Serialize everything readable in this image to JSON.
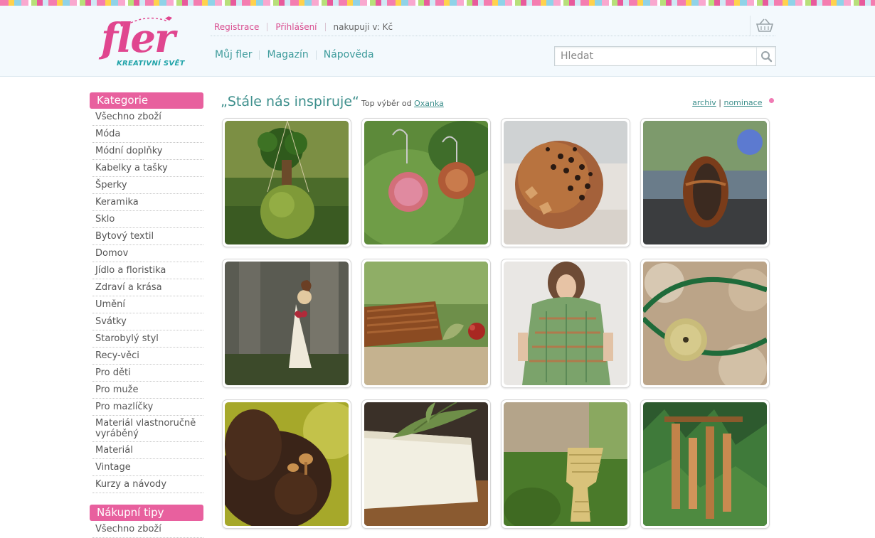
{
  "brand": {
    "logo_word": "fler",
    "logo_tagline": "KREATIVNÍ SVĚT"
  },
  "header": {
    "register": "Registrace",
    "login": "Přihlášení",
    "currency": "nakupuji v: Kč",
    "nav": [
      "Můj fler",
      "Magazín",
      "Nápověda"
    ],
    "search_placeholder": "Hledat"
  },
  "sidebar": {
    "categories_title": "Kategorie",
    "categories": [
      "Všechno zboží",
      "Móda",
      "Módní doplňky",
      "Kabelky a tašky",
      "Šperky",
      "Keramika",
      "Sklo",
      "Bytový textil",
      "Domov",
      "Jídlo a floristika",
      "Zdraví a krása",
      "Umění",
      "Svátky",
      "Starobylý styl",
      "Recy-věci",
      "Pro děti",
      "Pro muže",
      "Pro mazlíčky",
      "Materiál vlastnoručně vyráběný",
      "Materiál",
      "Vintage",
      "Kurzy a návody"
    ],
    "tips_title": "Nákupní tipy",
    "tips": [
      "Všechno zboží"
    ]
  },
  "main": {
    "title": "„Stále nás inspiruje“",
    "by_label": "Top výběr od",
    "by_user": "Oxanka",
    "archive": "archiv",
    "nominate": "nominace",
    "products": [
      {
        "icon": "kokedama-photo"
      },
      {
        "icon": "wooden-earrings-photo"
      },
      {
        "icon": "ceramic-lantern-photo"
      },
      {
        "icon": "wooden-ring-photo"
      },
      {
        "icon": "angel-figurine-photo"
      },
      {
        "icon": "wicker-basket-photo"
      },
      {
        "icon": "knitted-poncho-photo"
      },
      {
        "icon": "macrame-bracelet-photo"
      },
      {
        "icon": "hair-pin-photo"
      },
      {
        "icon": "soap-bar-photo"
      },
      {
        "icon": "woven-vase-photo"
      },
      {
        "icon": "wind-chime-photo"
      }
    ]
  },
  "colors": {
    "brand_pink": "#e0468f",
    "teal": "#3d8f8c",
    "side_head": "#e8609e"
  }
}
